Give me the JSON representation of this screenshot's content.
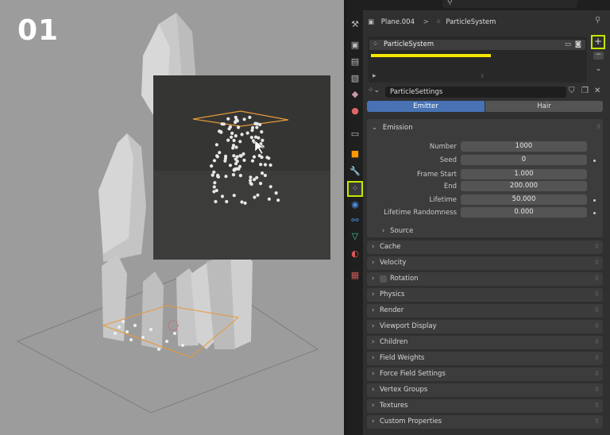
{
  "step_label": "01",
  "breadcrumb": {
    "object": "Plane.004",
    "sep": ">",
    "system": "ParticleSystem"
  },
  "particle_list": {
    "item": "ParticleSystem"
  },
  "settings": {
    "name": "ParticleSettings"
  },
  "tabs": {
    "emitter": "Emitter",
    "hair": "Hair"
  },
  "emission": {
    "title": "Emission",
    "fields": [
      {
        "label": "Number",
        "value": "1000"
      },
      {
        "label": "Seed",
        "value": "0"
      },
      {
        "label": "Frame Start",
        "value": "1.000"
      },
      {
        "label": "End",
        "value": "200.000"
      },
      {
        "label": "Lifetime",
        "value": "50.000"
      },
      {
        "label": "Lifetime Randomness",
        "value": "0.000"
      }
    ],
    "source": "Source"
  },
  "sections": [
    "Cache",
    "Velocity",
    "Rotation",
    "Physics",
    "Render",
    "Viewport Display",
    "Children",
    "Field Weights",
    "Force Field Settings",
    "Vertex Groups",
    "Textures",
    "Custom Properties"
  ],
  "colors": {
    "accent_blue": "#4772b3",
    "highlight": "#c8e600",
    "selection": "#f0a030",
    "underline_yellow": "#f5e800"
  },
  "icons": [
    "tool-icon",
    "render-icon",
    "output-icon",
    "view-layer-icon",
    "scene-icon",
    "world-icon",
    "collection-icon",
    "object-icon",
    "modifier-icon",
    "particles-icon",
    "physics-icon",
    "constraints-icon",
    "data-icon",
    "material-icon",
    "texture-icon"
  ]
}
